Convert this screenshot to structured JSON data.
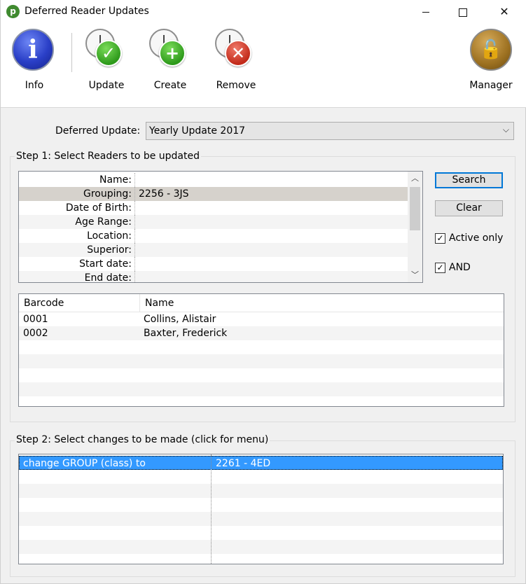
{
  "window": {
    "title": "Deferred Reader Updates"
  },
  "toolbar": {
    "info_label": "Info",
    "update_label": "Update",
    "create_label": "Create",
    "remove_label": "Remove",
    "manager_label": "Manager"
  },
  "deferred_update": {
    "label": "Deferred Update:",
    "selected": "Yearly Update 2017"
  },
  "step1": {
    "title": "Step 1: Select Readers to be updated",
    "fields": [
      {
        "name": "Name:",
        "value": ""
      },
      {
        "name": "Grouping:",
        "value": "2256 - 3JS"
      },
      {
        "name": "Date of Birth:",
        "value": ""
      },
      {
        "name": "Age Range:",
        "value": ""
      },
      {
        "name": "Location:",
        "value": ""
      },
      {
        "name": "Superior:",
        "value": ""
      },
      {
        "name": "Start date:",
        "value": ""
      },
      {
        "name": "End date:",
        "value": ""
      }
    ],
    "search_label": "Search",
    "clear_label": "Clear",
    "active_only": {
      "label": "Active only",
      "checked": true
    },
    "and": {
      "label": "AND",
      "checked": true
    },
    "results": {
      "columns": [
        "Barcode",
        "Name"
      ],
      "rows": [
        {
          "barcode": "0001",
          "name": "Collins, Alistair"
        },
        {
          "barcode": "0002",
          "name": "Baxter, Frederick"
        }
      ]
    }
  },
  "step2": {
    "title": "Step 2: Select changes to be made (click for menu)",
    "rows": [
      {
        "change": "change GROUP (class) to",
        "value": "2261 - 4ED"
      }
    ]
  }
}
